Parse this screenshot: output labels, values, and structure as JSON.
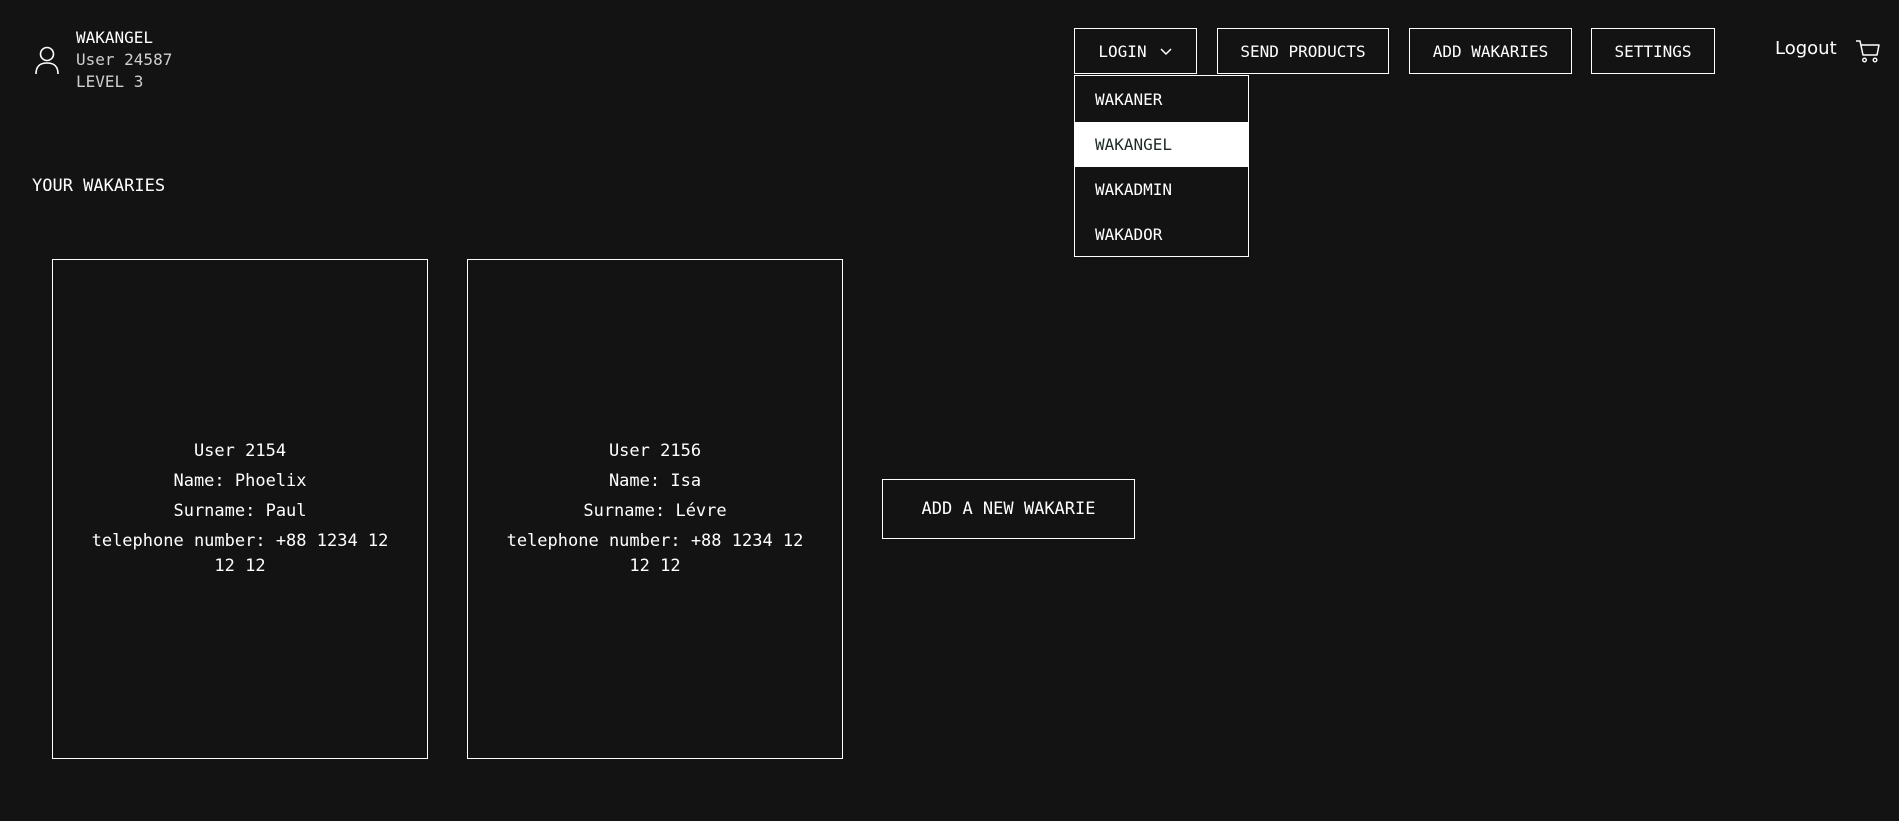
{
  "user": {
    "role": "WAKANGEL",
    "id": "User 24587",
    "level": "LEVEL 3",
    "icon": "user-icon"
  },
  "nav": {
    "login_label": "LOGIN",
    "send_products_label": "SEND PRODUCTS",
    "add_wakaries_label": "ADD WAKARIES",
    "settings_label": "SETTINGS",
    "logout_label": "Logout",
    "cart_icon": "cart-icon"
  },
  "dropdown": {
    "items": [
      {
        "label": "WAKANER",
        "active": false
      },
      {
        "label": "WAKANGEL",
        "active": true
      },
      {
        "label": "WAKADMIN",
        "active": false
      },
      {
        "label": "WAKADOR",
        "active": false
      }
    ]
  },
  "main": {
    "section_title": "YOUR WAKARIES",
    "wakaries": [
      {
        "user": "User 2154",
        "name": "Name: Phoelix",
        "surname": "Surname: Paul",
        "telephone": "telephone number: +88 1234 12 12 12"
      },
      {
        "user": "User 2156",
        "name": "Name: Isa",
        "surname": "Surname: Lévre",
        "telephone": "telephone number: +88 1234 12 12 12"
      }
    ],
    "add_new_label": "ADD A NEW WAKARIE"
  },
  "colors": {
    "background": "#131313",
    "foreground": "#ffffff",
    "active_item_text": "#1d2a26"
  }
}
